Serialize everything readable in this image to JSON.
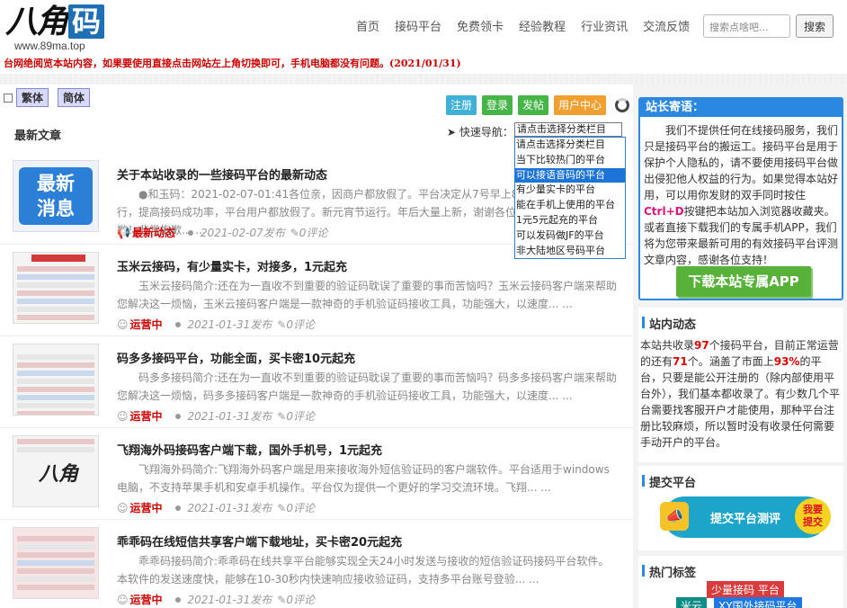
{
  "header": {
    "logo_ba": "八角",
    "logo_ma": "码",
    "logo_url": "www.89ma.top",
    "nav": [
      "首页",
      "接码平台",
      "免费领卡",
      "经验教程",
      "行业资讯",
      "交流反馈"
    ],
    "search_placeholder": "搜索点啥吧...",
    "search_button": "搜索"
  },
  "notice": "台网绝阅览本站内容，如果要使用直接点击网站左上角切换即可，手机电脑都没有问题。(2021/01/31)",
  "toolbar": {
    "lang_traditional": "繁体",
    "lang_simplified": "简体",
    "register": "注册",
    "login": "登录",
    "post": "发帖",
    "user_center": "用户中心"
  },
  "main": {
    "section_title": "最新文章",
    "quicknav_label": "快速导航：",
    "quicknav_selected": "请点击选择分类栏目",
    "quicknav_options": [
      "请点击选择分类栏目",
      "当下比较热门的平台",
      "可以接语音码的平台",
      "有少量实卡的平台",
      "能在手机上使用的平台",
      "1元5元起充的平台",
      "可以发码做JF的平台",
      "非大陆地区号码平台"
    ],
    "quicknav_highlight_index": 2,
    "articles": [
      {
        "thumb_text": "最新\n消息",
        "title": "关于本站收录的一些接码平台的最新动态",
        "summary": "●和玉码：2021-02-07-01:41各位亲，因商户都放假了。平台决定从7号早上8点开始系统停止运行，提高接码成功率，平台用户都放假了。新元宵节运行。年后大量上新，谢谢各位的支持理解，非常抱歉！非常抱歉... ...",
        "tag": "最新动态",
        "date": "2021-02-07发布",
        "comments": "0评论"
      },
      {
        "title": "玉米云接码，有少量实卡，对接多，1元起充",
        "summary": "玉米云接码简介:还在为一直收不到重要的验证码耽误了重要的事而苦恼吗？玉米云接码客户端来帮助您解决这一烦恼，玉米云接码客户端是一款神奇的手机验证码接收工具，功能强大，以速度... ...",
        "tag": "运营中",
        "date": "2021-01-31发布",
        "comments": "0评论"
      },
      {
        "title": "码多多接码平台，功能全面，买卡密10元起充",
        "summary": "码多多接码简介:还在为一直收不到重要的验证码耽误了重要的事而苦恼吗？码多多接码客户端来帮助您解决这一烦恼，码多多接码客户端是一款神奇的手机验证码接收工具，功能强大，以速度... ...",
        "tag": "运营中",
        "date": "2021-01-31发布",
        "comments": "0评论"
      },
      {
        "title": "飞翔海外码接码客户端下载，国外手机号，1元起充",
        "summary": "飞翔海外码简介:飞翔海外码客户端是用来接收海外短信验证码的客户端软件。平台适用于windows电脑，不支持苹果手机和安卓手机操作。平台仅为提供一个更好的学习交流环境。飞翔... ...",
        "tag": "运营中",
        "date": "2021-01-31发布",
        "comments": "0评论"
      },
      {
        "title": "乖乖码在线短信共享客户端下载地址，买卡密20元起充",
        "summary": "乖乖码接码简介:乖乖码在线共享平台能够实现全天24小时发送与接收的短信验证码接码平台软件。本软件的发送速度快，能够在10-30秒内快速响应接收验证码，支持多平台账号登验... ...",
        "tag": "运营中",
        "date": "2021-01-31发布",
        "comments": "0评论"
      }
    ]
  },
  "sidebar": {
    "note_title": "站长寄语：",
    "note_p1": "我们不提供任何在线接码服务，我们只是接码平台的搬运工。接码平台是用于保护个人隐私的，请不要使用接码平台做出侵犯他人权益的行为。如果觉得本站好用，可以用你发财的双手同时按住",
    "note_keys": "Ctrl+D",
    "note_p2": "按键把本站加入浏览器收藏夹。或者直接下载我们的专属手机APP，我们将为您带来最新可用的有效接码平台评测文章内容，感谢各位支持！",
    "app_button": "下载本站专属APP",
    "station_title": "站内动态",
    "station_text_a": "本站共收录",
    "station_total": "97",
    "station_text_b": "个接码平台，目前正常运营的还有",
    "station_active": "71",
    "station_text_c": "个。涵盖了市面上",
    "station_pct": "93%",
    "station_text_d": "的平台，只要是能公开注册的（除内部使用平台外），我们基本都收录了。有少数几个平台需要找客服开户才能使用，那种平台注册比较麻烦，所以暂时没有收录任何需要手动开户的平台。",
    "submit_title": "提交平台",
    "submit_banner": "提交平台测评",
    "submit_badge": "我要\n提交",
    "tags_title": "热门标签",
    "tag_a": "少量接码 平台",
    "tag_b": "米云",
    "tag_c": "XY国外接码平台"
  }
}
